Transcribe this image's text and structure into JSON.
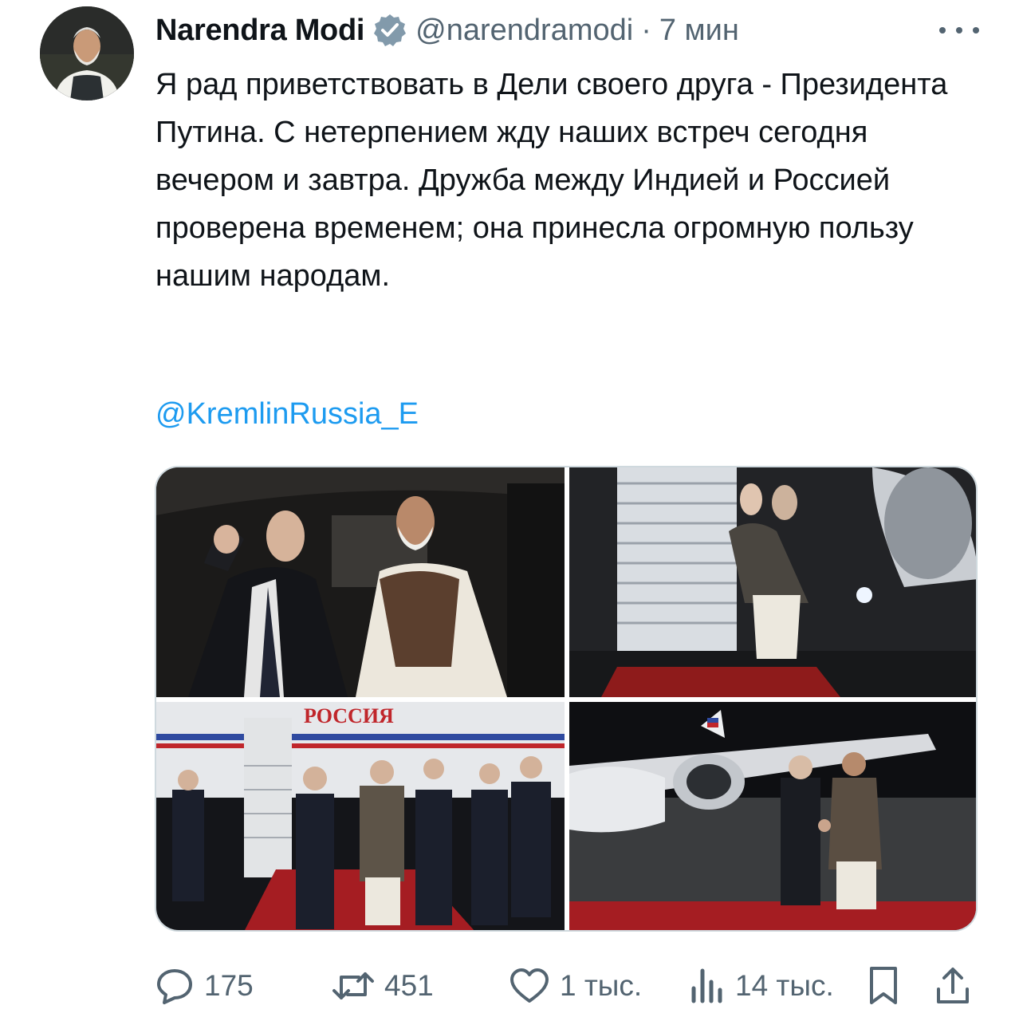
{
  "tweet": {
    "author_name": "Narendra Modi",
    "author_handle": "@narendramodi",
    "separator": "·",
    "time": "7 мин",
    "text": "Я рад приветствовать в Дели своего друга - Президента Путина. С нетерпением жду наших встреч сегодня вечером и завтра. Дружба между Индией и Россией проверена временем; она принесла огромную пользу нашим народам.",
    "mention": "@KremlinRussia_E",
    "photos": [
      {
        "name": "photo-car",
        "description_icon": "image"
      },
      {
        "name": "photo-stairs-hug",
        "description_icon": "image"
      },
      {
        "name": "photo-arrival-group",
        "description_icon": "image",
        "plane_text": "РОССИЯ"
      },
      {
        "name": "photo-handshake",
        "description_icon": "image"
      }
    ]
  },
  "actions": {
    "reply_count": "175",
    "retweet_count": "451",
    "like_count": "1 тыс.",
    "view_count": "14 тыс."
  },
  "icons": {
    "verified": "verified-badge-icon",
    "more": "more-dots-icon",
    "reply": "reply-icon",
    "retweet": "retweet-icon",
    "like": "heart-icon",
    "views": "views-icon",
    "bookmark": "bookmark-icon",
    "share": "share-icon"
  },
  "colors": {
    "text": "#0f1419",
    "secondary": "#536471",
    "link": "#1d9bf0",
    "border": "#cfd9de"
  }
}
